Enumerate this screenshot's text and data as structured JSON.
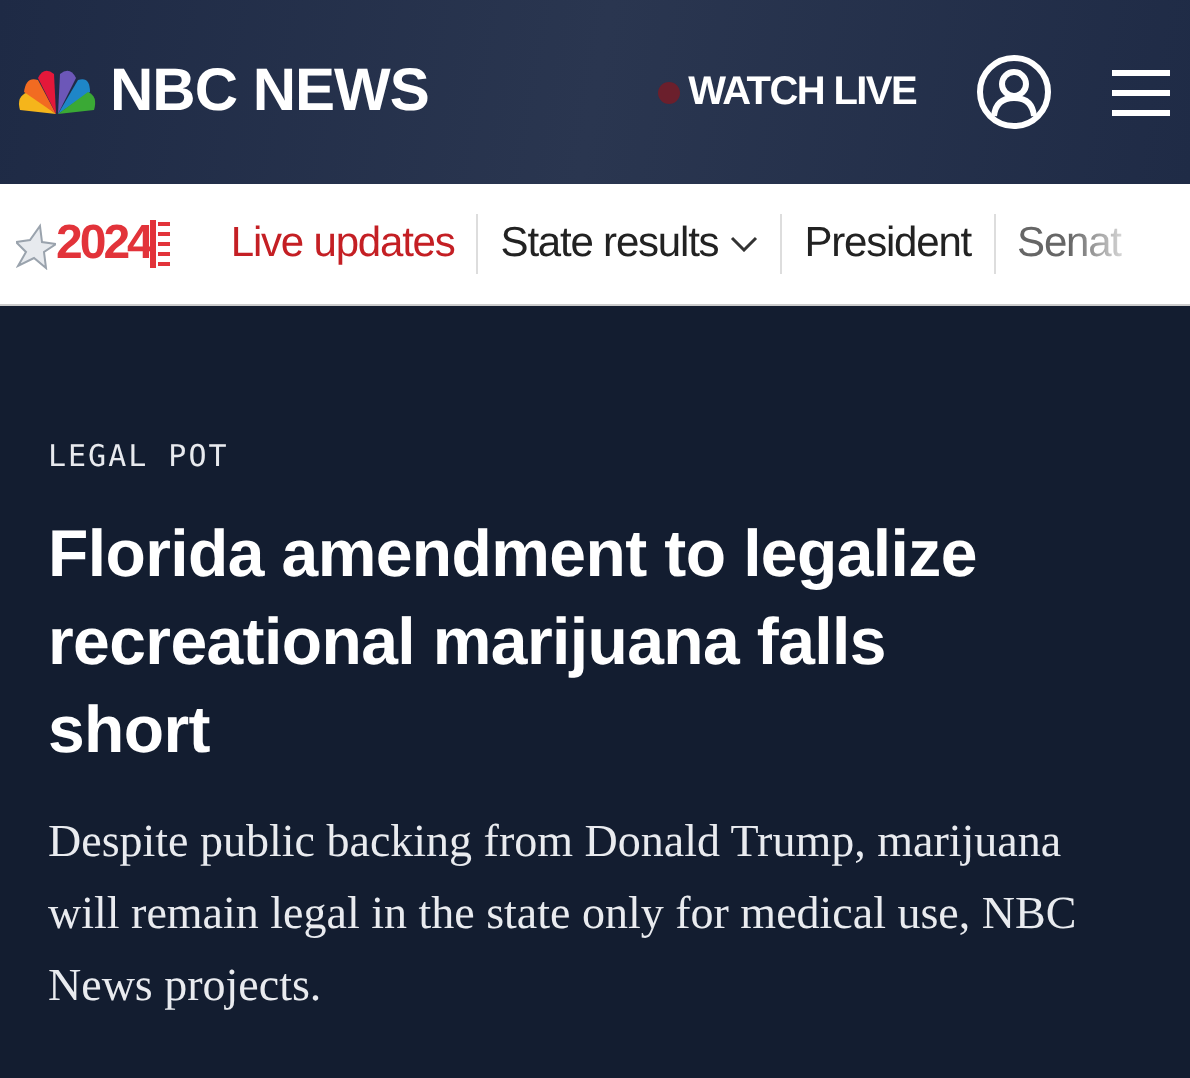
{
  "header": {
    "logo": "NBC NEWS",
    "watch_live": "WATCH LIVE"
  },
  "nav": {
    "logo_year": "2024",
    "items": [
      {
        "label": "Live updates",
        "kind": "live",
        "has_menu": false
      },
      {
        "label": "State results",
        "kind": "link",
        "has_menu": true
      },
      {
        "label": "President",
        "kind": "link",
        "has_menu": false
      },
      {
        "label": "Senat",
        "kind": "cut",
        "has_menu": false
      }
    ]
  },
  "article": {
    "kicker": "LEGAL POT",
    "headline": "Florida amendment to legalize recreational marijuana falls short",
    "dek": "Despite public backing from Donald Trump, marijuana will remain legal in the state only for medical use, NBC News projects."
  }
}
